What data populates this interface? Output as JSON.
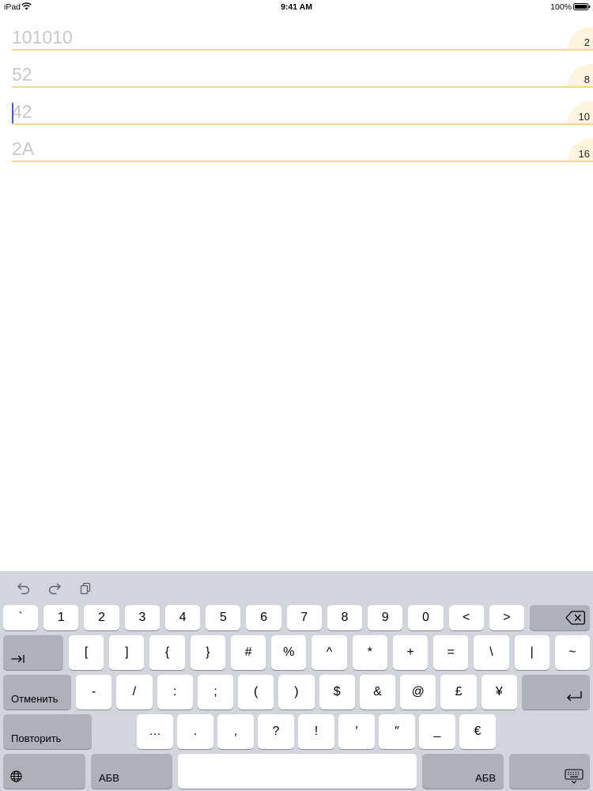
{
  "status_bar": {
    "device": "iPad",
    "time": "9:41 AM",
    "battery_text": "100%",
    "wifi_icon": "wifi-icon",
    "battery_icon": "battery-icon"
  },
  "converter": {
    "fields": [
      {
        "placeholder": "101010",
        "base": "2"
      },
      {
        "placeholder": "52",
        "base": "8"
      },
      {
        "placeholder": "42",
        "base": "10",
        "focused": true
      },
      {
        "placeholder": "2A",
        "base": "16"
      }
    ]
  },
  "keyboard": {
    "toolbar": {
      "undo_icon": "undo-icon",
      "redo_icon": "redo-icon",
      "paste_icon": "paste-icon"
    },
    "row1": [
      "`",
      "1",
      "2",
      "3",
      "4",
      "5",
      "6",
      "7",
      "8",
      "9",
      "0",
      "<",
      ">"
    ],
    "row2": [
      "[",
      "]",
      "{",
      "}",
      "#",
      "%",
      "^",
      "*",
      "+",
      "=",
      "\\",
      "|",
      "~"
    ],
    "row3": [
      "-",
      "/",
      ":",
      ";",
      "(",
      ")",
      "$",
      "&",
      "@",
      "£",
      "¥"
    ],
    "row4": [
      "…",
      ".",
      ",",
      "?",
      "!",
      "′",
      "″",
      "_",
      "€"
    ],
    "undo_label": "Отменить",
    "redo_label": "Повторить",
    "alphabet_label": "АБВ",
    "icons": {
      "delete": "backspace-icon",
      "tab": "tab-icon",
      "return": "return-icon",
      "globe": "globe-icon",
      "dismiss": "keyboard-dismiss-icon"
    }
  },
  "colors": {
    "field_underline": "#f6d98c",
    "base_badge": "#fdf4de",
    "placeholder_text": "#c7c7cd",
    "caret": "#3c5bd6",
    "keyboard_background": "#d2d5db",
    "key": "#ffffff",
    "function_key": "#acb1ba"
  }
}
